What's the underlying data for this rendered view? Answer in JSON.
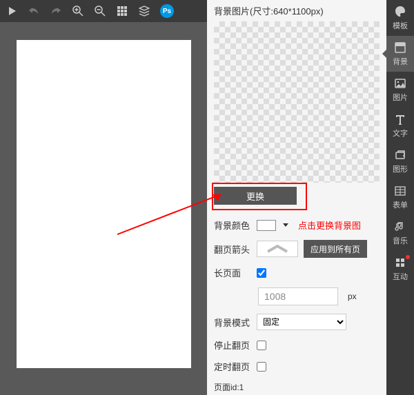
{
  "toolbar": {
    "ps_label": "Ps"
  },
  "rail": {
    "items": [
      {
        "label": "模板",
        "icon": "palette"
      },
      {
        "label": "背景",
        "icon": "background",
        "active": true
      },
      {
        "label": "图片",
        "icon": "image"
      },
      {
        "label": "文字",
        "icon": "text"
      },
      {
        "label": "图形",
        "icon": "shape"
      },
      {
        "label": "表单",
        "icon": "table"
      },
      {
        "label": "音乐",
        "icon": "music"
      },
      {
        "label": "互动",
        "icon": "interact",
        "dot": true
      }
    ]
  },
  "bg": {
    "title": "背景图片(尺寸:640*1100px)",
    "replace_label": "更换",
    "color_label": "背景颜色",
    "hint_text": "点击更换背景图",
    "arrow_label": "翻页箭头",
    "apply_all_label": "应用到所有页",
    "long_page_label": "长页面",
    "long_page_checked": true,
    "long_page_value": "1008",
    "long_page_unit": "px",
    "mode_label": "背景模式",
    "mode_value": "固定",
    "stop_flip_label": "停止翻页",
    "stop_flip_checked": false,
    "timed_flip_label": "定时翻页",
    "timed_flip_checked": false,
    "page_id_label": "页面id:1"
  }
}
